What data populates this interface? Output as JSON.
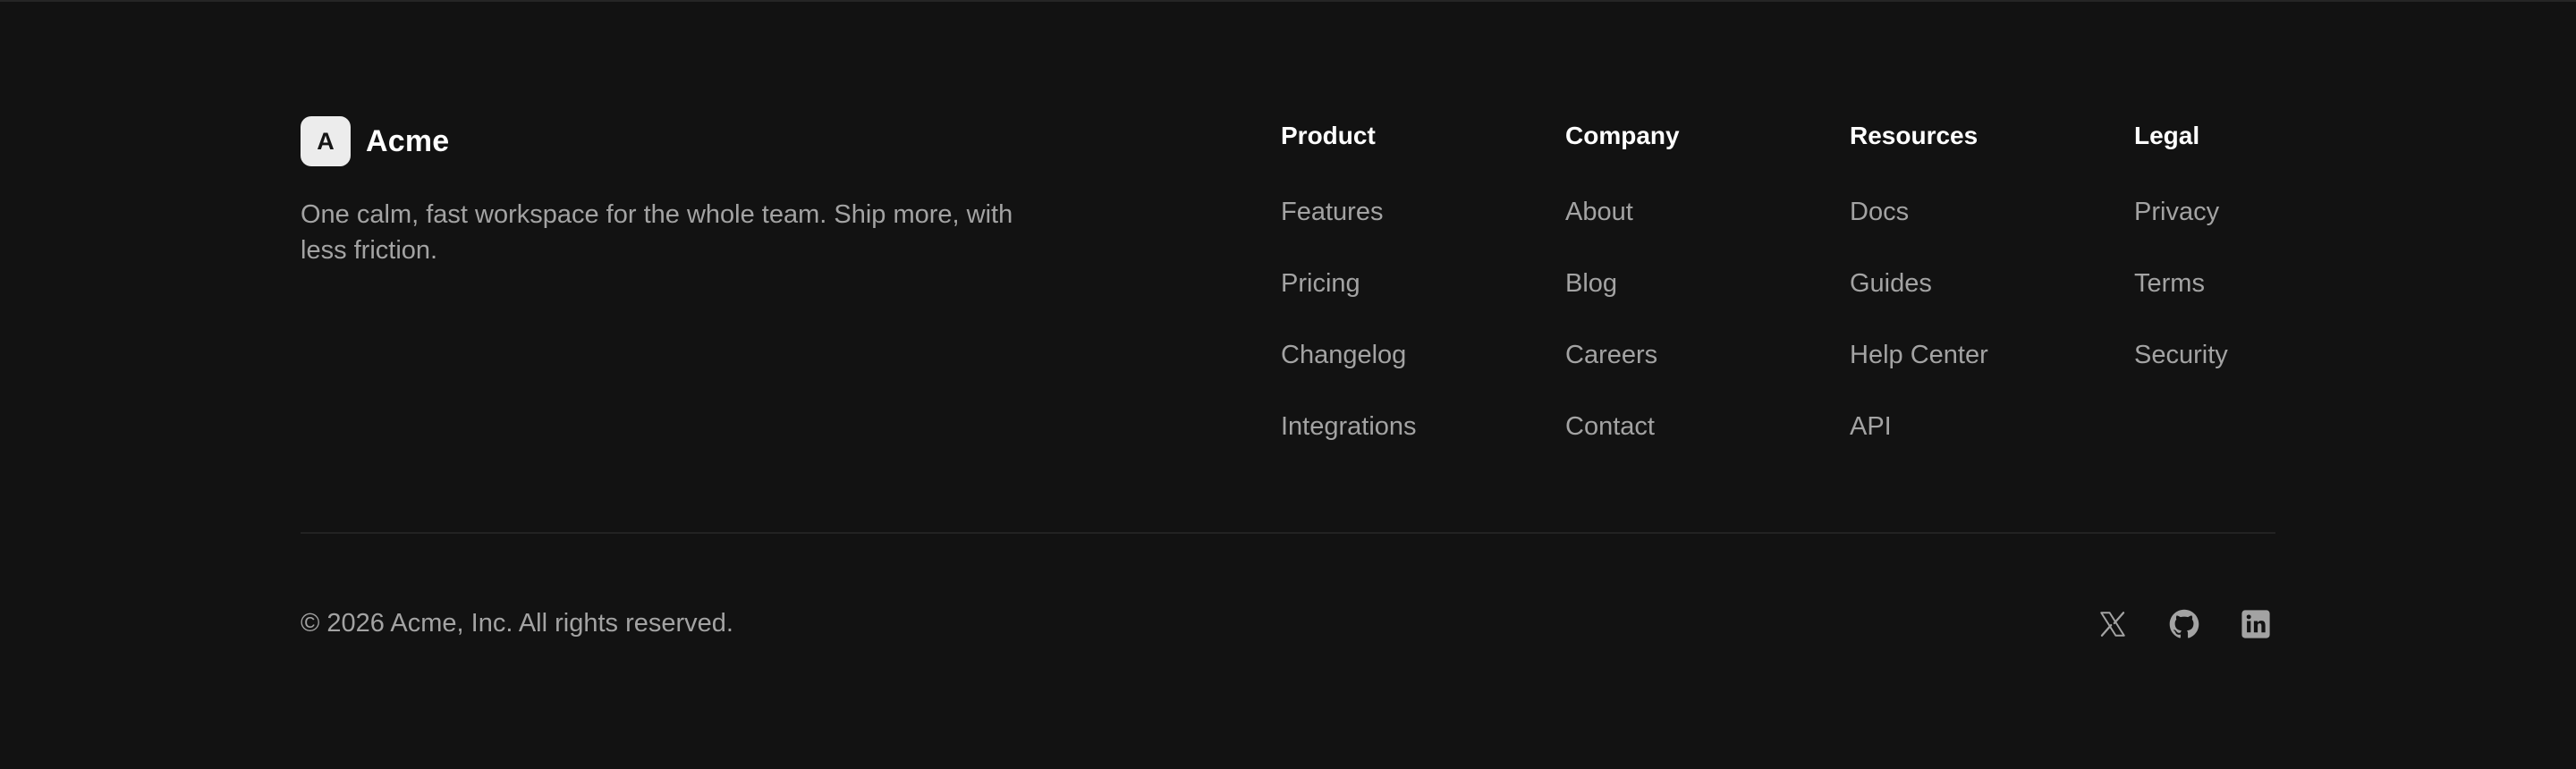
{
  "brand": {
    "logo_letter": "A",
    "name": "Acme",
    "tagline": "One calm, fast workspace for the whole team. Ship more, with less friction."
  },
  "columns": [
    {
      "title": "Product",
      "links": [
        "Features",
        "Pricing",
        "Changelog",
        "Integrations"
      ]
    },
    {
      "title": "Company",
      "links": [
        "About",
        "Blog",
        "Careers",
        "Contact"
      ]
    },
    {
      "title": "Resources",
      "links": [
        "Docs",
        "Guides",
        "Help Center",
        "API"
      ]
    },
    {
      "title": "Legal",
      "links": [
        "Privacy",
        "Terms",
        "Security"
      ]
    }
  ],
  "bottom": {
    "copyright": "© 2026 Acme, Inc. All rights reserved.",
    "socials": [
      {
        "icon": "x-icon"
      },
      {
        "icon": "github-icon"
      },
      {
        "icon": "linkedin-icon"
      }
    ]
  },
  "colors": {
    "background": "#121212",
    "heading": "#ffffff",
    "muted_text": "#a3a3a3",
    "divider": "#222222",
    "logo_badge": "#ececec"
  }
}
